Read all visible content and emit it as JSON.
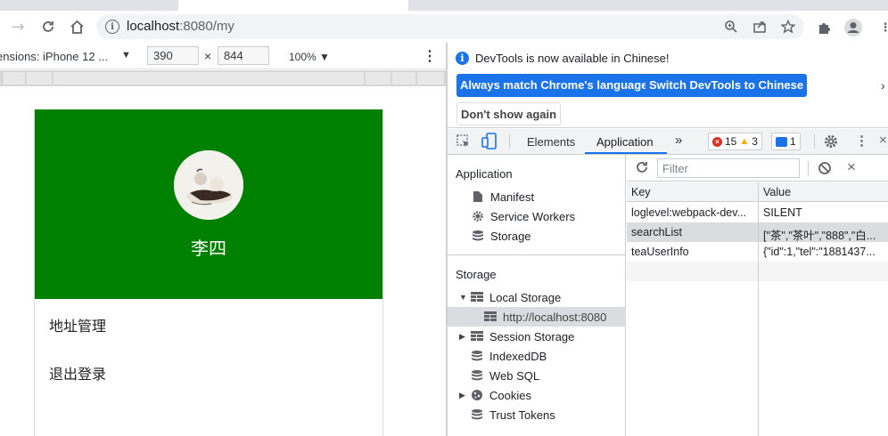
{
  "browser": {
    "url_host": "localhost",
    "url_rest": ":8080/my"
  },
  "device_toolbar": {
    "dimensions_label": "ensions: iPhone 12 ...",
    "width": "390",
    "height": "844",
    "zoom": "100%"
  },
  "app": {
    "username": "李四",
    "menu": [
      {
        "label": "地址管理"
      },
      {
        "label": "退出登录"
      }
    ],
    "header_color": "#008000"
  },
  "devtools": {
    "infobar": {
      "message": "DevTools is now available in Chinese!",
      "match_button": "Always match Chrome's language",
      "switch_button": "Switch DevTools to Chinese",
      "dismiss_button": "Don't show again"
    },
    "tabs": {
      "elements": "Elements",
      "application": "Application",
      "more": "»",
      "errors": "15",
      "warnings": "3",
      "messages": "1"
    },
    "sidebar": {
      "application_heading": "Application",
      "application_items": [
        {
          "label": "Manifest",
          "icon": "document-icon"
        },
        {
          "label": "Service Workers",
          "icon": "gear-icon"
        },
        {
          "label": "Storage",
          "icon": "database-icon"
        }
      ],
      "storage_heading": "Storage",
      "local_storage": "Local Storage",
      "local_storage_origin": "http://localhost:8080",
      "session_storage": "Session Storage",
      "indexeddb": "IndexedDB",
      "websql": "Web SQL",
      "cookies": "Cookies",
      "trust_tokens": "Trust Tokens"
    },
    "filter": {
      "placeholder": "Filter"
    },
    "table": {
      "key_header": "Key",
      "value_header": "Value",
      "rows": [
        {
          "key": "loglevel:webpack-dev...",
          "value": "SILENT"
        },
        {
          "key": "searchList",
          "value": "[\"茶\",\"茶叶\",\"888\",\"白..."
        },
        {
          "key": "teaUserInfo",
          "value": "{\"id\":1,\"tel\":\"1881437..."
        }
      ]
    },
    "accent": "#1a73e8"
  }
}
